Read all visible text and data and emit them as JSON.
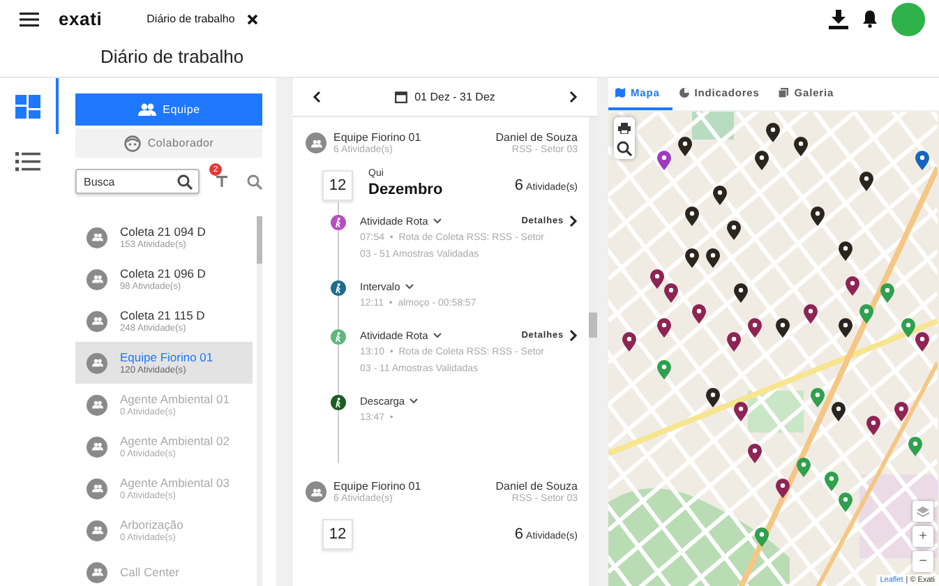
{
  "header": {
    "app_name": "exati",
    "tab": "Diário de trabalho"
  },
  "page_title": "Diário de trabalho",
  "rail": [
    {
      "kind": "dashboard",
      "selected": true
    },
    {
      "kind": "list",
      "selected": false
    }
  ],
  "mode_buttons": [
    {
      "kind": "team",
      "label": "Equipe",
      "selected": true
    },
    {
      "kind": "person",
      "label": "Colaborador",
      "selected": false
    }
  ],
  "search": {
    "placeholder": "Busca",
    "filter_badge": "2"
  },
  "teams": [
    {
      "name": "Coleta 21 094 D",
      "count": "153 Atividade(s)",
      "selected": false,
      "active": true
    },
    {
      "name": "Coleta 21 096 D",
      "count": "98 Atividade(s)",
      "selected": false,
      "active": true
    },
    {
      "name": "Coleta 21 115 D",
      "count": "248 Atividade(s)",
      "selected": false,
      "active": true
    },
    {
      "name": "Equipe Fiorino 01",
      "count": "120 Atividade(s)",
      "selected": true,
      "active": true
    },
    {
      "name": "Agente Ambiental 01",
      "count": "0 Atividade(s)",
      "selected": false,
      "active": false
    },
    {
      "name": "Agente Ambiental 02",
      "count": "0 Atividade(s)",
      "selected": false,
      "active": false
    },
    {
      "name": "Agente Ambiental 03",
      "count": "0 Atividade(s)",
      "selected": false,
      "active": false
    },
    {
      "name": "Arborização",
      "count": "0 Atividade(s)",
      "selected": false,
      "active": false
    },
    {
      "name": "Call Center",
      "selected": false,
      "active": false
    }
  ],
  "journal": {
    "date_range": "01 Dez - 31 Dez",
    "groups": [
      {
        "team": "Equipe Fiorino 01",
        "count": "6 Atividade(s)",
        "person": "Daniel de Souza",
        "sector": "RSS - Setor 03",
        "day": "12",
        "weekday": "Qui",
        "month": "Dezembro",
        "day_count": "6",
        "day_count_label": "Atividade(s)",
        "activities": [
          {
            "title": "Atividade Rota",
            "time": "07:54  •",
            "description": "Rota de Coleta RSS: RSS - Setor 03 - 51 Amostras Validadas",
            "color": "#b64fc0",
            "details": "Detalhes"
          },
          {
            "title": "Intervalo",
            "time": "12:11  •",
            "description": "almoço - 00:58:57",
            "color": "#1c6e8c"
          },
          {
            "title": "Atividade Rota",
            "time": "13:10  •",
            "description": "Rota de Coleta RSS: RSS - Setor 03 - 11 Amostras Validadas",
            "color": "#5cb87c",
            "details": "Detalhes"
          },
          {
            "title": "Descarga",
            "time": "13:47  •",
            "color": "#1b5e20"
          }
        ]
      },
      {
        "team": "Equipe Fiorino 01",
        "count": "6 Atividade(s)",
        "person": "Daniel de Souza",
        "sector": "RSS - Setor 03",
        "day": "12",
        "day_count": "6",
        "day_count_label": "Atividade(s)"
      }
    ]
  },
  "map": {
    "tabs": [
      {
        "kind": "map",
        "label": "Mapa",
        "selected": true
      },
      {
        "kind": "chart",
        "label": "Indicadores",
        "selected": false
      },
      {
        "kind": "gallery",
        "label": "Galeria",
        "selected": false
      }
    ],
    "zoom_in": "+",
    "zoom_out": "−",
    "attribution_link": "Leaflet",
    "attribution_text": "| © Exati"
  }
}
